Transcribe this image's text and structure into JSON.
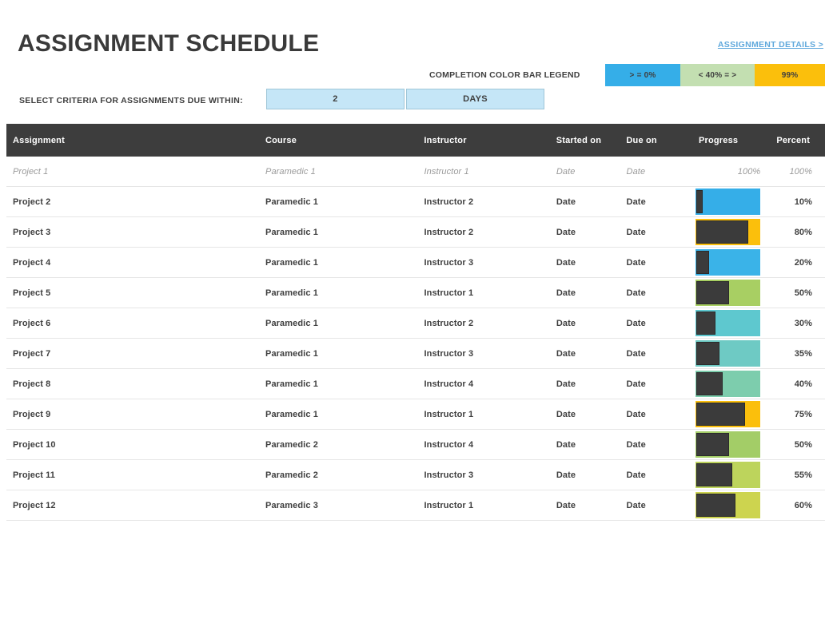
{
  "header": {
    "title": "ASSIGNMENT SCHEDULE",
    "details_link": "ASSIGNMENT DETAILS >"
  },
  "legend": {
    "label": "COMPLETION COLOR BAR LEGEND",
    "cells": [
      {
        "text": ">  =  0%",
        "color": "#35aee8",
        "width": 94
      },
      {
        "text": "<  40%  =  >",
        "color": "#c3dfb1",
        "width": 93
      },
      {
        "text": "99%",
        "color": "#fbbf0c",
        "width": 88
      }
    ]
  },
  "criteria": {
    "label": "SELECT CRITERIA FOR ASSIGNMENTS DUE WITHIN:",
    "value": "2",
    "unit": "DAYS"
  },
  "table": {
    "columns": [
      {
        "key": "assignment",
        "label": "Assignment"
      },
      {
        "key": "course",
        "label": "Course"
      },
      {
        "key": "instructor",
        "label": "Instructor"
      },
      {
        "key": "started",
        "label": "Started on"
      },
      {
        "key": "due",
        "label": "Due on"
      },
      {
        "key": "progress",
        "label": "Progress"
      },
      {
        "key": "percent",
        "label": "Percent"
      }
    ],
    "rows": [
      {
        "assignment": "Project 1",
        "course": "Paramedic 1",
        "instructor": "Instructor 1",
        "started": "Date",
        "due": "Date",
        "progress_text": "100%",
        "percent": "100%",
        "template": true
      },
      {
        "assignment": "Project 2",
        "course": "Paramedic 1",
        "instructor": "Instructor 2",
        "started": "Date",
        "due": "Date",
        "value": 10,
        "percent": "10%",
        "color": "#35aee8",
        "template": false
      },
      {
        "assignment": "Project 3",
        "course": "Paramedic 1",
        "instructor": "Instructor 2",
        "started": "Date",
        "due": "Date",
        "value": 80,
        "percent": "80%",
        "color": "#fbbf0c",
        "template": false
      },
      {
        "assignment": "Project 4",
        "course": "Paramedic 1",
        "instructor": "Instructor 3",
        "started": "Date",
        "due": "Date",
        "value": 20,
        "percent": "20%",
        "color": "#3ab3e8",
        "template": false
      },
      {
        "assignment": "Project 5",
        "course": "Paramedic 1",
        "instructor": "Instructor 1",
        "started": "Date",
        "due": "Date",
        "value": 50,
        "percent": "50%",
        "color": "#a8cf63",
        "template": false
      },
      {
        "assignment": "Project 6",
        "course": "Paramedic 1",
        "instructor": "Instructor 2",
        "started": "Date",
        "due": "Date",
        "value": 30,
        "percent": "30%",
        "color": "#5ec8cf",
        "template": false
      },
      {
        "assignment": "Project 7",
        "course": "Paramedic 1",
        "instructor": "Instructor 3",
        "started": "Date",
        "due": "Date",
        "value": 35,
        "percent": "35%",
        "color": "#6ecac4",
        "template": false
      },
      {
        "assignment": "Project 8",
        "course": "Paramedic 1",
        "instructor": "Instructor 4",
        "started": "Date",
        "due": "Date",
        "value": 40,
        "percent": "40%",
        "color": "#7dcdad",
        "template": false
      },
      {
        "assignment": "Project 9",
        "course": "Paramedic 1",
        "instructor": "Instructor 1",
        "started": "Date",
        "due": "Date",
        "value": 75,
        "percent": "75%",
        "color": "#fbbf0c",
        "template": false
      },
      {
        "assignment": "Project 10",
        "course": "Paramedic 2",
        "instructor": "Instructor 4",
        "started": "Date",
        "due": "Date",
        "value": 50,
        "percent": "50%",
        "color": "#a3cd67",
        "template": false
      },
      {
        "assignment": "Project 11",
        "course": "Paramedic 2",
        "instructor": "Instructor 3",
        "started": "Date",
        "due": "Date",
        "value": 55,
        "percent": "55%",
        "color": "#bdd45c",
        "template": false
      },
      {
        "assignment": "Project 12",
        "course": "Paramedic 3",
        "instructor": "Instructor 1",
        "started": "Date",
        "due": "Date",
        "value": 60,
        "percent": "60%",
        "color": "#cdd44f",
        "template": false
      }
    ]
  },
  "chart_data": {
    "type": "bar",
    "title": "Assignment completion progress",
    "categories": [
      "Project 1",
      "Project 2",
      "Project 3",
      "Project 4",
      "Project 5",
      "Project 6",
      "Project 7",
      "Project 8",
      "Project 9",
      "Project 10",
      "Project 11",
      "Project 12"
    ],
    "values": [
      100,
      10,
      80,
      20,
      50,
      30,
      35,
      40,
      75,
      50,
      55,
      60
    ],
    "xlabel": "Percent",
    "ylabel": "Assignment",
    "ylim": [
      0,
      100
    ],
    "legend": [
      ">  =  0%",
      "<  40%  =  >",
      "99%"
    ]
  }
}
